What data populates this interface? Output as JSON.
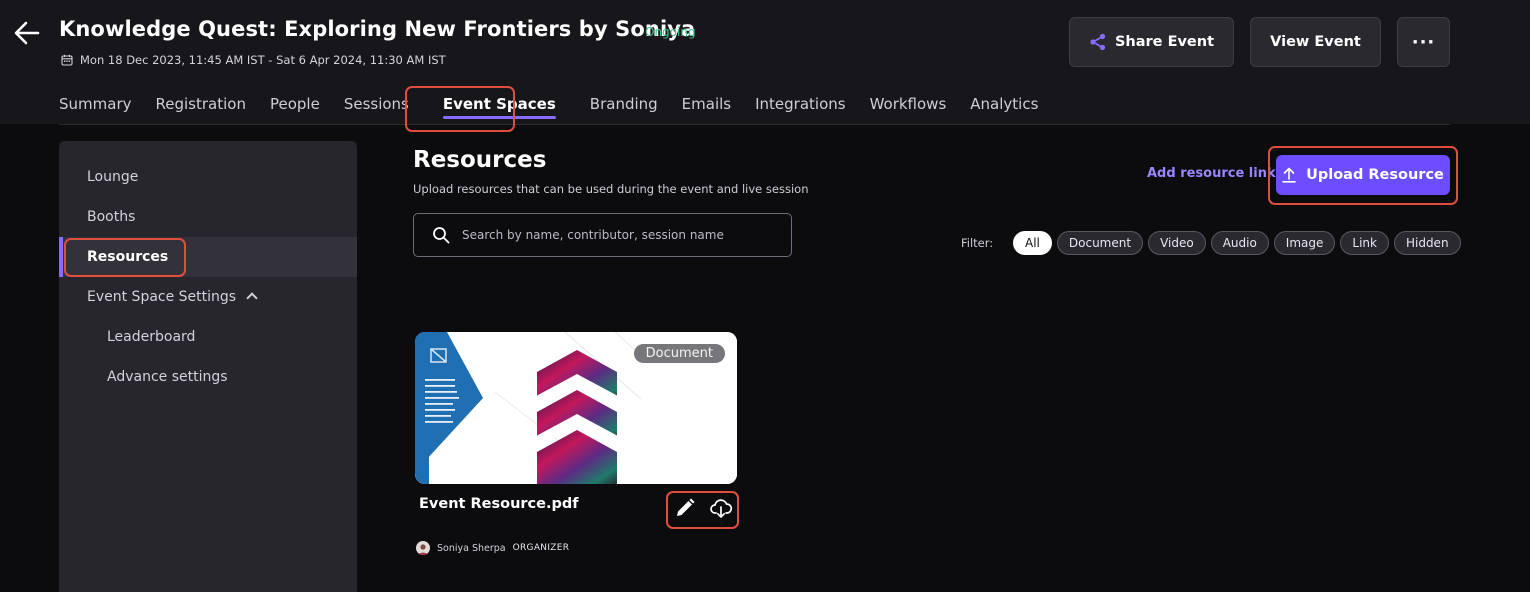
{
  "header": {
    "title": "Knowledge Quest: Exploring New Frontiers by Soniya",
    "status": "Ongoing",
    "date_range": "Mon 18 Dec 2023, 11:45 AM IST - Sat 6 Apr 2024, 11:30 AM IST",
    "share_label": "Share Event",
    "view_label": "View Event",
    "more_label": "···"
  },
  "tabs": [
    {
      "label": "Summary"
    },
    {
      "label": "Registration"
    },
    {
      "label": "People"
    },
    {
      "label": "Sessions"
    },
    {
      "label": "Event Spaces"
    },
    {
      "label": "Branding"
    },
    {
      "label": "Emails"
    },
    {
      "label": "Integrations"
    },
    {
      "label": "Workflows"
    },
    {
      "label": "Analytics"
    }
  ],
  "active_tab": "Event Spaces",
  "sidebar": {
    "items": [
      {
        "label": "Lounge"
      },
      {
        "label": "Booths"
      },
      {
        "label": "Resources"
      },
      {
        "label": "Event Space Settings"
      },
      {
        "label": "Leaderboard"
      },
      {
        "label": "Advance settings"
      }
    ],
    "active": "Resources"
  },
  "main": {
    "title": "Resources",
    "subtitle": "Upload resources that can be used during the event and live session",
    "add_link_label": "Add resource link",
    "upload_label": "Upload Resource",
    "search_placeholder": "Search by name, contributor, session name",
    "filter_label": "Filter:",
    "filters": [
      "All",
      "Document",
      "Video",
      "Audio",
      "Image",
      "Link",
      "Hidden"
    ],
    "active_filter": "All"
  },
  "resources": [
    {
      "name": "Event Resource.pdf",
      "type": "Document",
      "author": "Soniya Sherpa",
      "role": "ORGANIZER"
    }
  ],
  "colors": {
    "accent": "#6d4dff",
    "accent_text": "#9a86ff",
    "status_green": "#3fc28c",
    "highlight": "#e04e3d",
    "background": "#0c0b0e",
    "header_bg": "#17161b",
    "sidebar_bg": "#27262c"
  },
  "icons": {
    "back": "arrow-left-icon",
    "calendar": "calendar-icon",
    "share": "share-icon",
    "upload": "upload-icon",
    "search": "search-icon",
    "edit": "pencil-icon",
    "download": "cloud-download-icon",
    "expand": "chevron-up-icon"
  }
}
